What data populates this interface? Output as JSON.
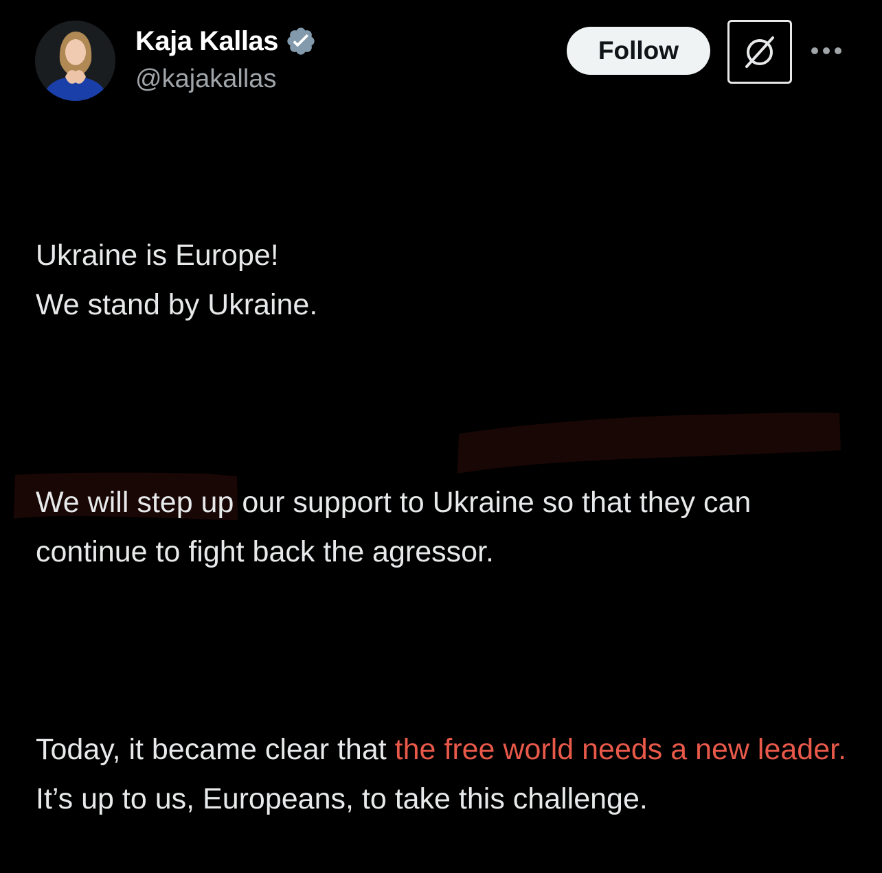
{
  "author": {
    "display_name": "Kaja Kallas",
    "handle": "@kajakallas",
    "verified": true
  },
  "actions": {
    "follow_label": "Follow",
    "grok_icon": "slashed-circle-icon",
    "more_icon": "more-dots-icon"
  },
  "tweet": {
    "paragraph_1_line_1": "Ukraine is Europe!",
    "paragraph_1_line_2": "We stand by Ukraine.",
    "paragraph_2": "We will step up our support to Ukraine so that they can continue to fight back the agressor.",
    "paragraph_3_before": "Today, it became clear that",
    "paragraph_3_highlight": "the free world needs a new leader.",
    "paragraph_3_after": "It’s up to us, Europeans, to take this challenge."
  },
  "colors": {
    "background": "#000000",
    "text": "#e7e9ea",
    "handle": "#a0a5aa",
    "verified_badge": "#829aab",
    "highlight_marker": "#c0392b",
    "highlight_text": "#e8594a",
    "follow_button_bg": "#eff3f4"
  }
}
